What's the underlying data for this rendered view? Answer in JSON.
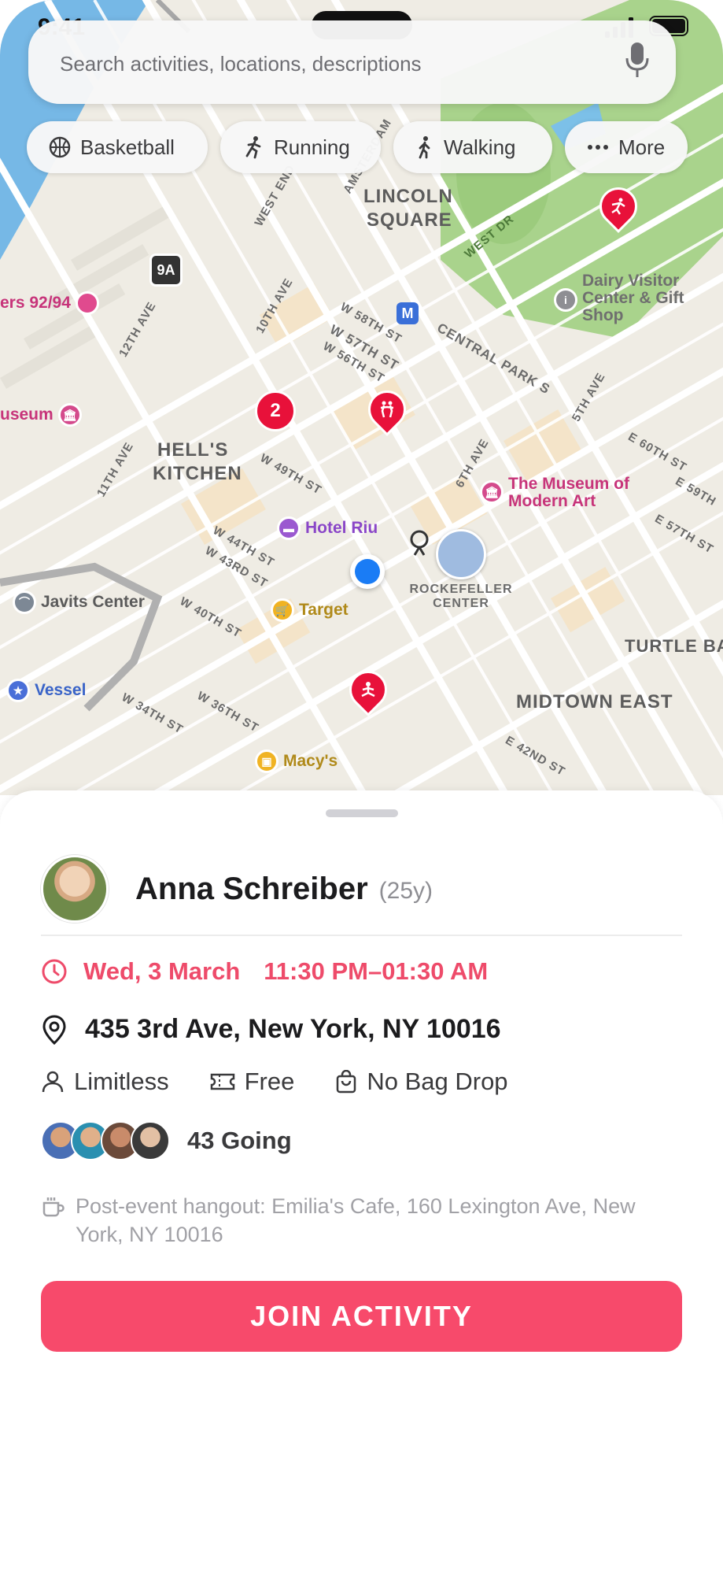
{
  "status_bar": {
    "time": "9:41"
  },
  "search": {
    "placeholder": "Search activities, locations, descriptions"
  },
  "filters": [
    {
      "label": "Basketball",
      "icon": "basketball-icon"
    },
    {
      "label": "Running",
      "icon": "running-icon"
    },
    {
      "label": "Walking",
      "icon": "walking-icon"
    },
    {
      "label": "More",
      "icon": "ellipsis-icon"
    }
  ],
  "map": {
    "areas": [
      "LINCOLN",
      "SQUARE",
      "HELL'S",
      "KITCHEN",
      "MIDTOWN EAST",
      "TURTLE BAY"
    ],
    "streets": [
      "WEST END",
      "AMSTERDAM",
      "10TH AVE",
      "12TH AVE",
      "11TH AVE",
      "W 58TH ST",
      "W 57TH ST",
      "W 56TH ST",
      "W 49TH ST",
      "W 44TH ST",
      "W 43RD ST",
      "W 40TH ST",
      "W 36TH ST",
      "W 34TH ST",
      "CENTRAL PARK S",
      "6TH AVE",
      "5TH AVE",
      "E 60TH ST",
      "E 59TH",
      "E 57TH ST",
      "E 42ND ST",
      "WEST DR",
      "9A",
      "M"
    ],
    "pois": {
      "dairy": "Dairy Visitor Center & Gift Shop",
      "piers": "ers 92/94",
      "museum": "useum",
      "moma": "The Museum of Modern Art",
      "hotel": "Hotel Riu",
      "javits": "Javits Center",
      "target": "Target",
      "rockefeller": "ROCKEFELLER CENTER",
      "vessel": "Vessel",
      "macys": "Macy's"
    },
    "cluster_count": "2",
    "accent": "#e8113a",
    "user_location_color": "#1a7cf5"
  },
  "event": {
    "host_name": "Anna Schreiber",
    "host_age": "(25y)",
    "date": "Wed, 3 March",
    "time": "11:30 PM–01:30 AM",
    "address": "435 3rd Ave, New York, NY 10016",
    "capacity": "Limitless",
    "price": "Free",
    "bag_drop": "No Bag Drop",
    "going": "43 Going",
    "hangout": "Post-event hangout: Emilia's Cafe, 160 Lexington Ave, New York, NY 10016",
    "join_label": "JOIN ACTIVITY",
    "accent": "#f74a6b"
  }
}
